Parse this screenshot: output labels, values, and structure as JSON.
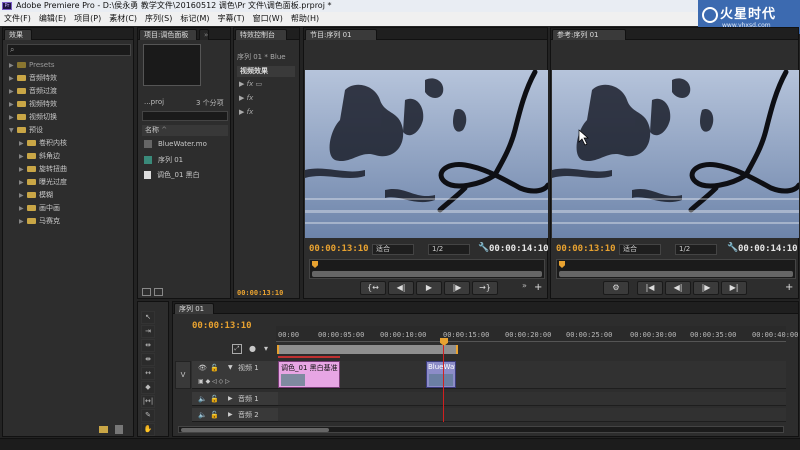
{
  "window": {
    "title": "Adobe Premiere Pro - D:\\侯永勇 教学文件\\20160512 调色\\Pr 文件\\调色面板.prproj *",
    "app_badge": "Pr"
  },
  "menu": [
    "文件(F)",
    "编辑(E)",
    "项目(P)",
    "素材(C)",
    "序列(S)",
    "标记(M)",
    "字幕(T)",
    "窗口(W)",
    "帮助(H)"
  ],
  "watermark": {
    "main": "火星时代",
    "sub": "www.vhxsd.com"
  },
  "effects": {
    "tab": "效果",
    "items": [
      {
        "label": "Presets",
        "dim": true
      },
      {
        "label": "音频特效"
      },
      {
        "label": "音频过渡"
      },
      {
        "label": "视频特效"
      },
      {
        "label": "视频切换"
      },
      {
        "label": "预设",
        "expanded": true
      },
      {
        "label": "卷积内核",
        "child": true
      },
      {
        "label": "斜角边",
        "child": true
      },
      {
        "label": "旋转扭曲",
        "child": true
      },
      {
        "label": "曝光过度",
        "child": true
      },
      {
        "label": "模糊",
        "child": true
      },
      {
        "label": "画中画",
        "child": true
      },
      {
        "label": "马赛克",
        "child": true
      }
    ]
  },
  "project": {
    "tab": "项目:调色面板",
    "file_label": "...proj",
    "count_label": "3 个分项",
    "name_header": "名称",
    "items": [
      "BlueWater.mo",
      "序列 01",
      "调色_01 黑白"
    ]
  },
  "effect_controls": {
    "tab": "特效控制台",
    "seq_label": "序列 01 * Blue",
    "section": "视频效果",
    "timecode": "00:00:13:10"
  },
  "program_monitor": {
    "tab": "节目:序列 01",
    "timecode_current": "00:00:13:10",
    "zoom": "适合",
    "quality": "1/2",
    "timecode_total": "00:00:14:10"
  },
  "reference_monitor": {
    "tab": "参考:序列 01",
    "timecode_current": "00:00:13:10",
    "zoom": "适合",
    "quality": "1/2",
    "timecode_total": "00:00:14:10"
  },
  "timeline": {
    "tab": "序列 01",
    "timecode": "00:00:13:10",
    "ruler": [
      "00:00",
      "00:00:05:00",
      "00:00:10:00",
      "00:00:15:00",
      "00:00:20:00",
      "00:00:25:00",
      "00:00:30:00",
      "00:00:35:00",
      "00:00:40:00"
    ],
    "tracks": {
      "video1": "视频 1",
      "audio1": "音频 1",
      "audio2": "音频 2"
    },
    "clips": {
      "adjust": "调色_01 黑白基准",
      "bluewater": "BlueWat"
    }
  },
  "colors": {
    "accent_orange": "#e8a230",
    "clip_pink": "#e7a6e4",
    "playhead_red": "#d02020"
  }
}
